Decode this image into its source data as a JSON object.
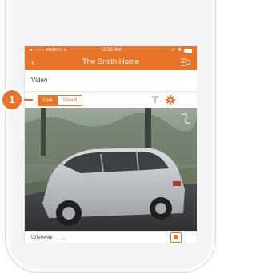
{
  "status_bar": {
    "carrier": "●○○○○ Verizon ᯤ",
    "time": "10:58 AM"
  },
  "nav": {
    "back_glyph": "‹",
    "title": "The Smith Home"
  },
  "section": {
    "label": "Video"
  },
  "segments": {
    "live": "Live",
    "saved": "Saved"
  },
  "camera": {
    "name": "Driveway",
    "chevron": "︿"
  },
  "callout": {
    "number": "1"
  },
  "colors": {
    "accent": "#e8742a"
  }
}
